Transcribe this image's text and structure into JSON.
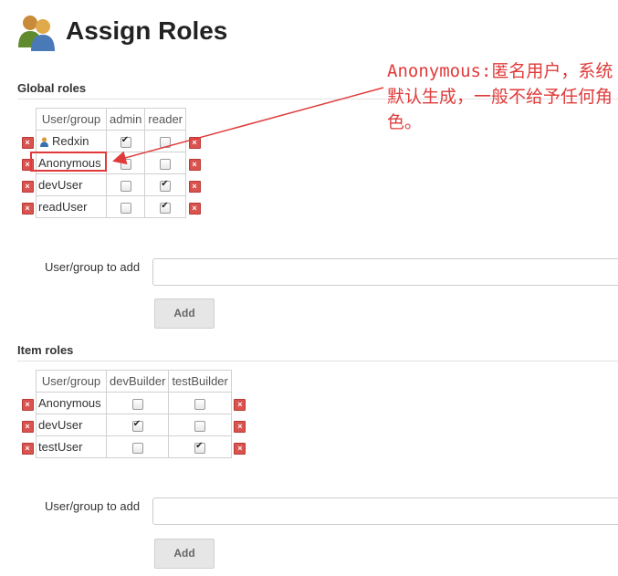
{
  "header": {
    "title": "Assign Roles",
    "logo_icon": "users-icon"
  },
  "global_roles": {
    "title": "Global roles",
    "columns": [
      "User/group",
      "admin",
      "reader"
    ],
    "rows": [
      {
        "name": "Redxin",
        "has_user_icon": true,
        "checks": [
          true,
          false
        ]
      },
      {
        "name": "Anonymous",
        "has_user_icon": false,
        "checks": [
          false,
          false
        ]
      },
      {
        "name": "devUser",
        "has_user_icon": false,
        "checks": [
          false,
          true
        ]
      },
      {
        "name": "readUser",
        "has_user_icon": false,
        "checks": [
          false,
          true
        ]
      }
    ],
    "add_label": "User/group to add",
    "add_button": "Add"
  },
  "item_roles": {
    "title": "Item roles",
    "columns": [
      "User/group",
      "devBuilder",
      "testBuilder"
    ],
    "rows": [
      {
        "name": "Anonymous",
        "checks": [
          false,
          false
        ]
      },
      {
        "name": "devUser",
        "checks": [
          true,
          false
        ]
      },
      {
        "name": "testUser",
        "checks": [
          false,
          true
        ]
      }
    ],
    "add_label": "User/group to add",
    "add_button": "Add"
  },
  "annotation": {
    "text": "Anonymous:匿名用户，系统默认生成，一般不给予任何角色。",
    "color": "#e03a3a"
  }
}
